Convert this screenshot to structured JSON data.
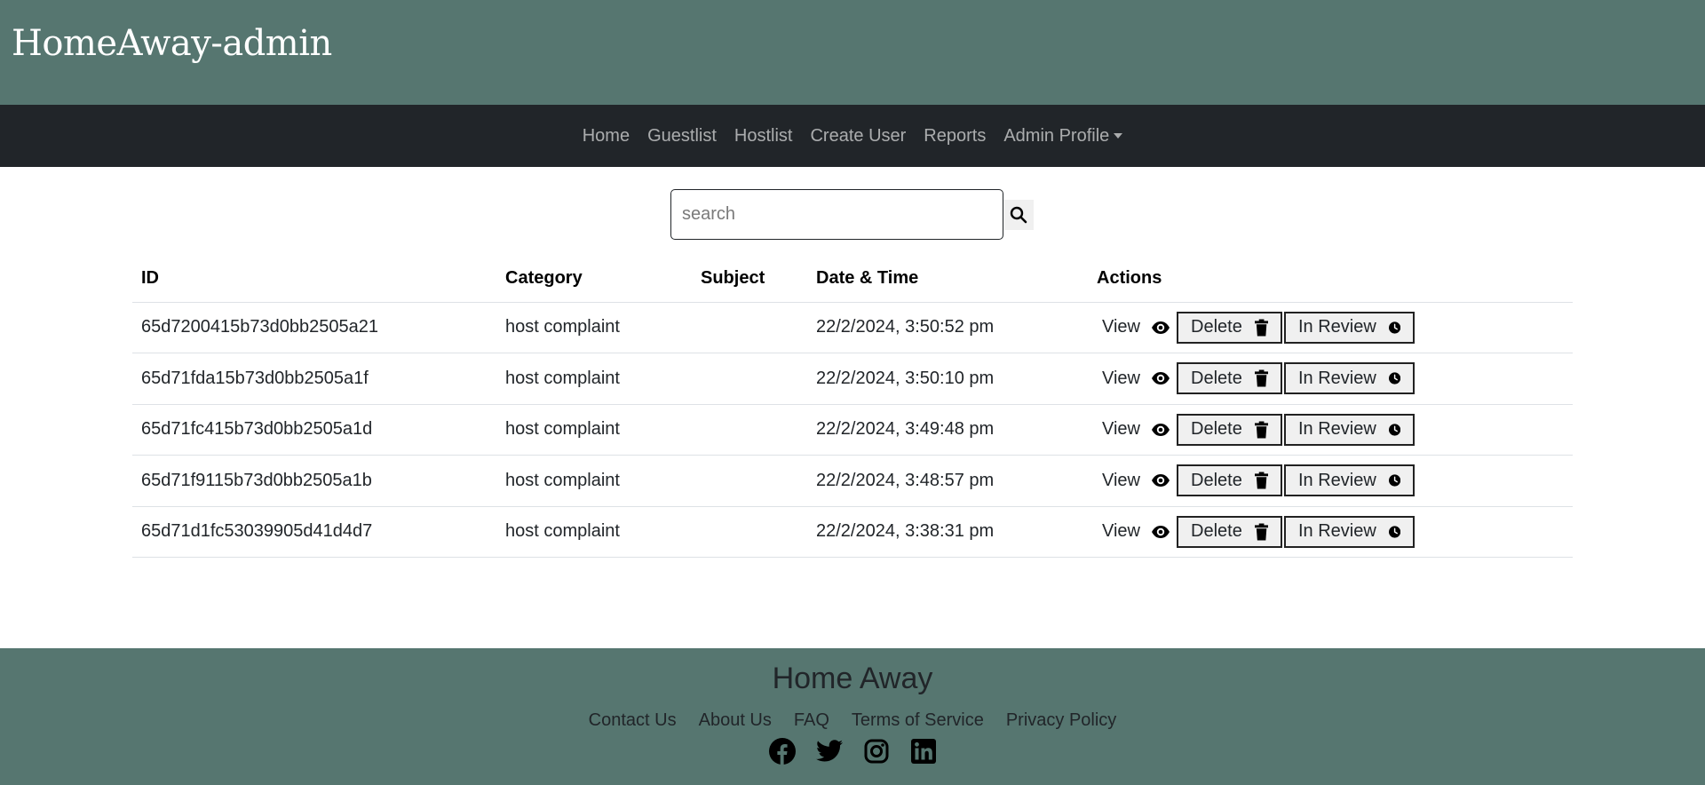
{
  "header": {
    "brand": "HomeAway-admin"
  },
  "nav": {
    "items": [
      "Home",
      "Guestlist",
      "Hostlist",
      "Create User",
      "Reports"
    ],
    "dropdown_label": "Admin Profile"
  },
  "search": {
    "placeholder": "search",
    "value": ""
  },
  "table": {
    "columns": [
      "ID",
      "Category",
      "Subject",
      "Date & Time",
      "Actions"
    ],
    "rows": [
      {
        "id": "65d7200415b73d0bb2505a21",
        "category": "host complaint",
        "subject": "",
        "datetime": "22/2/2024, 3:50:52 pm"
      },
      {
        "id": "65d71fda15b73d0bb2505a1f",
        "category": "host complaint",
        "subject": "",
        "datetime": "22/2/2024, 3:50:10 pm"
      },
      {
        "id": "65d71fc415b73d0bb2505a1d",
        "category": "host complaint",
        "subject": "",
        "datetime": "22/2/2024, 3:49:48 pm"
      },
      {
        "id": "65d71f9115b73d0bb2505a1b",
        "category": "host complaint",
        "subject": "",
        "datetime": "22/2/2024, 3:48:57 pm"
      },
      {
        "id": "65d71d1fc53039905d41d4d7",
        "category": "host complaint",
        "subject": "",
        "datetime": "22/2/2024, 3:38:31 pm"
      }
    ],
    "actions": {
      "view": "View",
      "delete": "Delete",
      "review": "In Review"
    }
  },
  "footer": {
    "title": "Home Away",
    "links": [
      "Contact Us",
      "About Us",
      "FAQ",
      "Terms of Service",
      "Privacy Policy"
    ],
    "socials": [
      "facebook-icon",
      "twitter-icon",
      "instagram-icon",
      "linkedin-icon"
    ]
  },
  "colors": {
    "header_bg": "#567670",
    "navbar_bg": "#212529",
    "footer_bg": "#567670"
  }
}
